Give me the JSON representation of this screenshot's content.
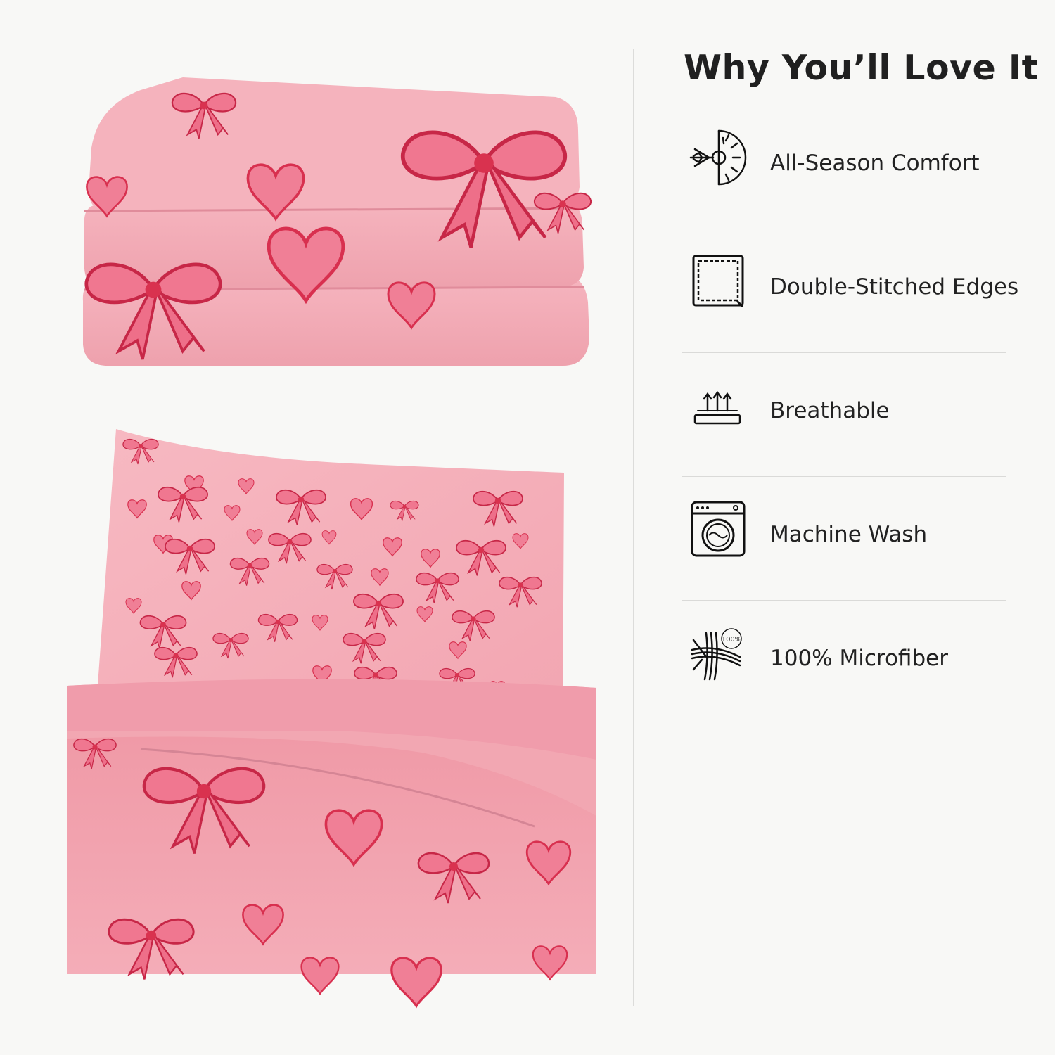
{
  "heading": "Why You’ll Love It",
  "features": [
    {
      "label": "All-Season Comfort",
      "icon": "sun-snow-icon"
    },
    {
      "label": "Double-Stitched Edges",
      "icon": "stitched-square-icon"
    },
    {
      "label": "Breathable",
      "icon": "airflow-arrows-icon"
    },
    {
      "label": "Machine Wash",
      "icon": "washing-machine-icon"
    },
    {
      "label": "100% Microfiber",
      "icon": "microfiber-weave-icon"
    }
  ],
  "icon_badge_text": "100%",
  "colors": {
    "fabric_pink": "#f2a9b4",
    "bow_red": "#e2445f",
    "background": "#f8f8f6",
    "text": "#222222"
  }
}
